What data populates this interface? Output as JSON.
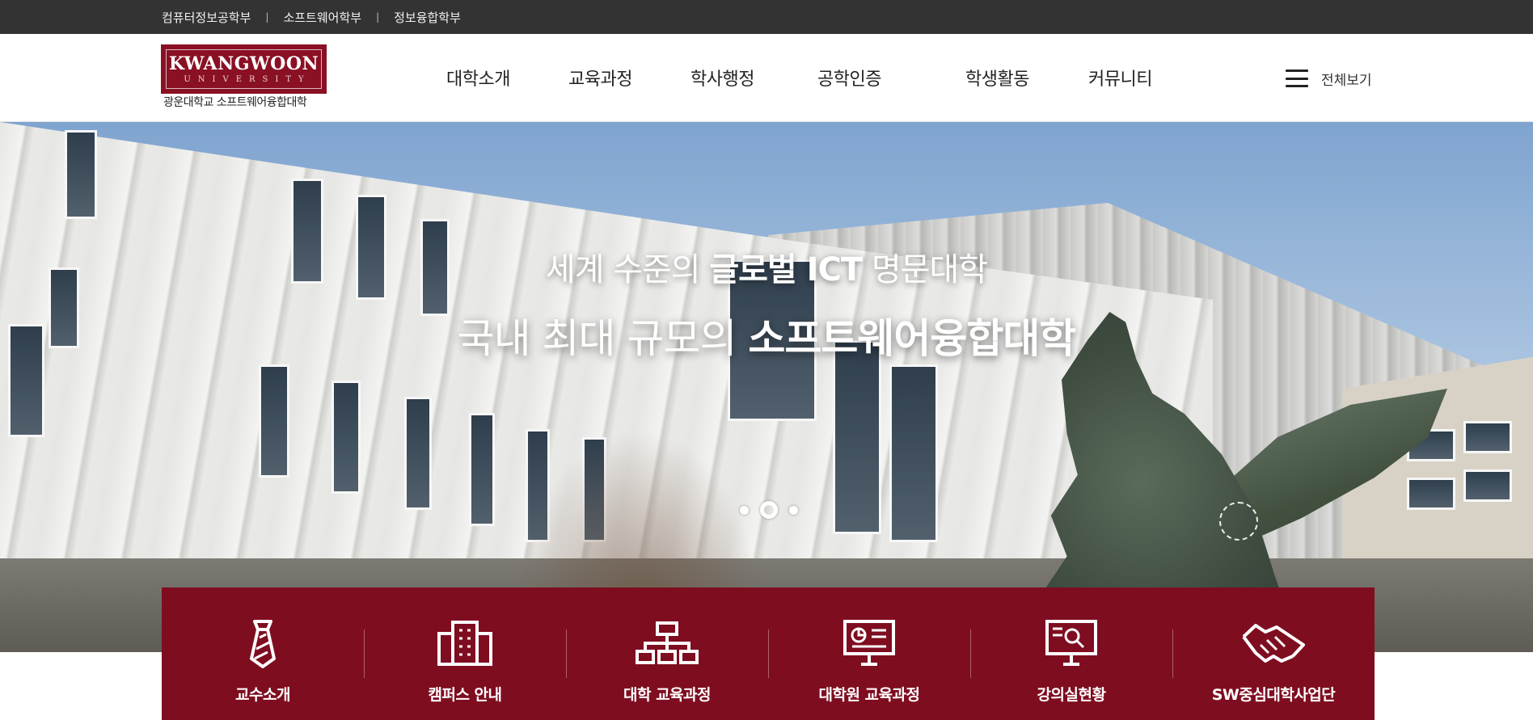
{
  "topbar": {
    "links": [
      "컴퓨터정보공학부",
      "소프트웨어학부",
      "정보융합학부"
    ],
    "separator": "|"
  },
  "header": {
    "logo_name": "KWANGWOON",
    "logo_sub": "UNIVERSITY",
    "logo_caption": "광운대학교 소프트웨어융합대학",
    "nav": [
      "대학소개",
      "교육과정",
      "학사행정",
      "공학인증",
      "학생활동",
      "커뮤니티"
    ],
    "menu_all_label": "전체보기"
  },
  "hero": {
    "line1_light": "세계 수준의 ",
    "line1_bold": "글로벌 ICT",
    "line1_tail": " 명문대학",
    "line2_light": "국내 최대 규모의 ",
    "line2_bold": "소프트웨어융합대학",
    "slides_total": 3,
    "slide_active": 2
  },
  "quick_menu": [
    {
      "label": "교수소개",
      "icon": "necktie-icon"
    },
    {
      "label": "캠퍼스 안내",
      "icon": "building-icon"
    },
    {
      "label": "대학 교육과정",
      "icon": "org-chart-icon"
    },
    {
      "label": "대학원 교육과정",
      "icon": "monitor-chart-icon"
    },
    {
      "label": "강의실현황",
      "icon": "monitor-search-icon"
    },
    {
      "label": "SW중심대학사업단",
      "icon": "handshake-icon"
    }
  ],
  "colors": {
    "brand": "#7f0d20",
    "topbar": "#333333"
  }
}
